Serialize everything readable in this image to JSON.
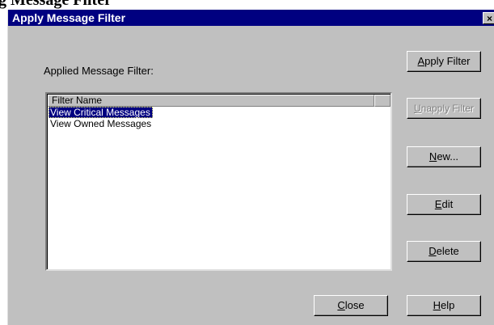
{
  "caption_fragment": "g Message Filter",
  "window": {
    "title": "Apply Message Filter",
    "close_glyph": "×"
  },
  "main": {
    "list_label": "Applied Message Filter:",
    "list_header": "Filter Name",
    "rows": [
      {
        "label": "View Critical Messages",
        "selected": true
      },
      {
        "label": "View Owned Messages",
        "selected": false
      }
    ]
  },
  "buttons": {
    "apply_filter": {
      "mnemonic": "A",
      "rest": "pply Filter"
    },
    "unapply_filter": {
      "mnemonic": "U",
      "rest": "napply Filter"
    },
    "new": {
      "mnemonic": "N",
      "rest": "ew..."
    },
    "edit": {
      "mnemonic": "E",
      "rest": "dit"
    },
    "delete": {
      "mnemonic": "D",
      "rest": "elete"
    },
    "close": {
      "mnemonic": "C",
      "rest": "lose"
    },
    "help": {
      "mnemonic": "H",
      "rest": "elp"
    }
  }
}
